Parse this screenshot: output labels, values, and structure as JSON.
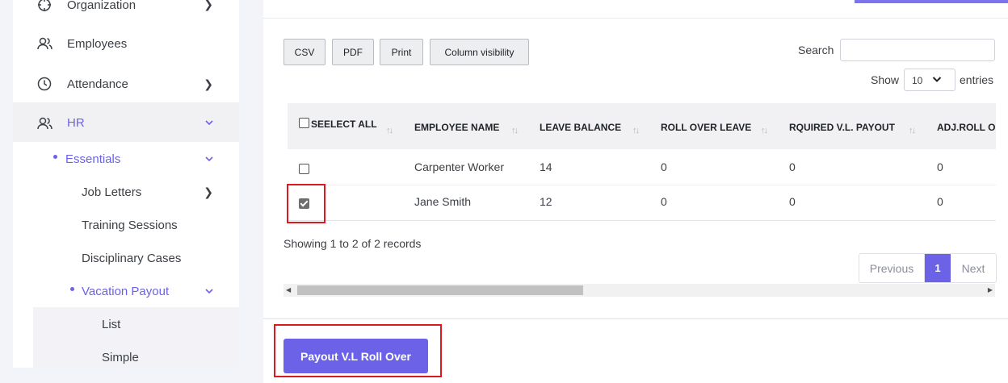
{
  "sidebar": {
    "items": [
      {
        "label": "Organization",
        "icon": "crosshair-icon",
        "has_chevron": true
      },
      {
        "label": "Employees",
        "icon": "users-icon",
        "has_chevron": false
      },
      {
        "label": "Attendance",
        "icon": "clock-icon",
        "has_chevron": true
      },
      {
        "label": "HR",
        "icon": "users-icon",
        "has_chevron": true,
        "active": true
      }
    ],
    "essentials": {
      "label": "Essentials"
    },
    "essentials_children": [
      "Job Letters",
      "Training Sessions",
      "Disciplinary Cases"
    ],
    "vacation_payout": {
      "label": "Vacation Payout"
    },
    "vacation_children": [
      "List",
      "Simple"
    ]
  },
  "toolbar": {
    "csv_label": "CSV",
    "pdf_label": "PDF",
    "print_label": "Print",
    "colvis_label": "Column visibility",
    "search_label": "Search",
    "search_value": "",
    "show_label": "Show",
    "show_value": "10",
    "entries_label": "entries"
  },
  "table": {
    "columns": [
      "SEELECT ALL",
      "EMPLOYEE NAME",
      "LEAVE BALANCE",
      "ROLL OVER LEAVE",
      "RQUIRED V.L. PAYOUT",
      "ADJ.ROLL O"
    ],
    "rows": [
      {
        "checked": false,
        "name": "Carpenter Worker",
        "leave_balance": "14",
        "roll_over": "0",
        "required_payout": "0",
        "adj_roll": "0"
      },
      {
        "checked": true,
        "name": "Jane Smith",
        "leave_balance": "12",
        "roll_over": "0",
        "required_payout": "0",
        "adj_roll": "0"
      }
    ]
  },
  "footer": {
    "showing_text": "Showing 1 to 2 of 2 records",
    "previous_label": "Previous",
    "current_page": "1",
    "next_label": "Next"
  },
  "actions": {
    "payout_label": "Payout V.L Roll Over"
  },
  "colors": {
    "accent": "#6b62e8",
    "highlight_box": "#e0171c"
  }
}
